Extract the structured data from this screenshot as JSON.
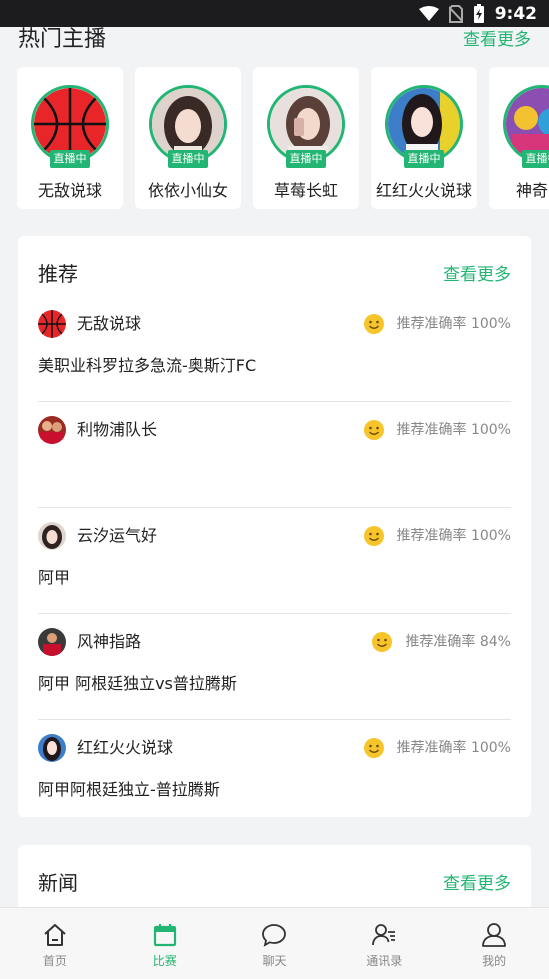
{
  "status_bar": {
    "time": "9:42"
  },
  "hot_hosts": {
    "title": "热门主播",
    "more": "查看更多",
    "live_label": "直播中",
    "items": [
      {
        "name": "无敌说球",
        "avatar": "basketball"
      },
      {
        "name": "依依小仙女",
        "avatar": "girl"
      },
      {
        "name": "草莓长虹",
        "avatar": "girl-phone"
      },
      {
        "name": "红红火火说球",
        "avatar": "girl-2"
      },
      {
        "name": "神奇Sa",
        "avatar": "team"
      }
    ]
  },
  "recommend": {
    "title": "推荐",
    "more": "查看更多",
    "items": [
      {
        "name": "无敌说球",
        "rate": "推荐准确率 100%",
        "match": "美职业科罗拉多急流-奥斯汀FC",
        "avatar": "basketball"
      },
      {
        "name": "利物浦队长",
        "rate": "推荐准确率 100%",
        "match": "",
        "avatar": "players"
      },
      {
        "name": "云汐运气好",
        "rate": "推荐准确率 100%",
        "match": "阿甲",
        "avatar": "girl"
      },
      {
        "name": "风神指路",
        "rate": "推荐准确率 84%",
        "match": "阿甲 阿根廷独立vs普拉腾斯",
        "avatar": "player-red"
      },
      {
        "name": "红红火火说球",
        "rate": "推荐准确率 100%",
        "match": "阿甲阿根廷独立-普拉腾斯",
        "avatar": "girl-2"
      }
    ]
  },
  "news": {
    "title": "新闻",
    "more": "查看更多"
  },
  "bottom_nav": [
    {
      "label": "首页",
      "icon": "home-icon",
      "active": false
    },
    {
      "label": "比赛",
      "icon": "calendar-icon",
      "active": true
    },
    {
      "label": "聊天",
      "icon": "chat-icon",
      "active": false
    },
    {
      "label": "通讯录",
      "icon": "contacts-icon",
      "active": false
    },
    {
      "label": "我的",
      "icon": "profile-icon",
      "active": false
    }
  ],
  "colors": {
    "accent": "#22b573",
    "status_bar": "#1c1c1e",
    "smile": "#f7c52b"
  }
}
